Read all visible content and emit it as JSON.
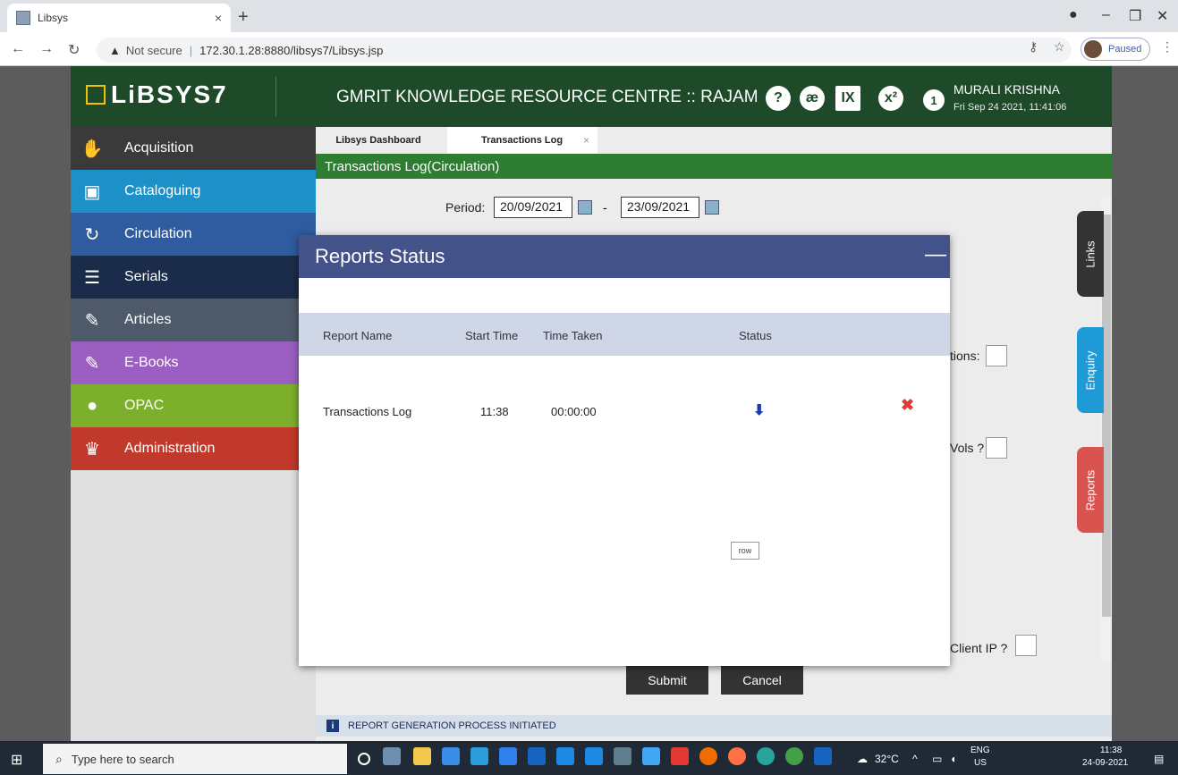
{
  "browser": {
    "tab_title": "Libsys",
    "tab_close": "×",
    "new_tab": "+",
    "url_warning": "▲",
    "url_secure_label": "Not secure",
    "url_separator": "|",
    "url": "172.30.1.28:8880/libsys7/Libsys.jsp",
    "profile_status": "Paused"
  },
  "header": {
    "logo_text": "LiBSYS7",
    "title": "GMRIT KNOWLEDGE RESOURCE CENTRE :: RAJAM",
    "notification_count": "1",
    "user_name": "MURALI KRISHNA",
    "user_datetime": "Fri Sep 24 2021, 11:41:06"
  },
  "sidebar": {
    "items": [
      {
        "label": "Acquisition",
        "icon": "handshake-icon",
        "color": "#3a3a3a"
      },
      {
        "label": "Cataloguing",
        "icon": "catalog-icon",
        "color": "#1e90c8"
      },
      {
        "label": "Circulation",
        "icon": "refresh-icon",
        "color": "#2f5c9e"
      },
      {
        "label": "Serials",
        "icon": "books-icon",
        "color": "#1b2c4a"
      },
      {
        "label": "Articles",
        "icon": "edit-icon",
        "color": "#4e5a6a"
      },
      {
        "label": "E-Books",
        "icon": "edit-icon",
        "color": "#9a5fc0"
      },
      {
        "label": "OPAC",
        "icon": "opac-icon",
        "color": "#7cb02c"
      },
      {
        "label": "Administration",
        "icon": "crown-icon",
        "color": "#c0392b"
      }
    ]
  },
  "content": {
    "tabs": [
      {
        "label": "Libsys Dashboard"
      },
      {
        "label": "Transactions Log"
      }
    ],
    "tab_close": "×",
    "section_title": "Transactions Log(Circulation)",
    "period_label": "Period:",
    "period_from": "20/09/2021",
    "period_to": "23/09/2021",
    "period_separator": "-",
    "option_label_1": "tions:",
    "option_label_2": "Vols ?",
    "option_label_3": "Client IP ?",
    "submit_label": "Submit",
    "cancel_label": "Cancel",
    "info_message": "REPORT GENERATION PROCESS INITIATED",
    "info_icon": "i",
    "side_tabs": [
      {
        "label": "Links",
        "color": "#333333"
      },
      {
        "label": "Enquiry",
        "color": "#1e9bd7"
      },
      {
        "label": "Reports",
        "color": "#d9534f"
      }
    ]
  },
  "modal": {
    "title": "Reports Status",
    "minimize": "—",
    "columns": [
      "Report Name",
      "Start Time",
      "Time Taken",
      "Status"
    ],
    "rows": [
      {
        "report_name": "Transactions Log",
        "start_time": "11:38",
        "time_taken": "00:00:00",
        "status_icon": "download-arrow-icon",
        "delete_icon": "delete-x-icon"
      }
    ],
    "row_tag": "row",
    "header_color": "#43538a"
  },
  "taskbar": {
    "search_placeholder": "Type here to search",
    "weather": "32°C",
    "lang_1": "ENG",
    "lang_2": "US",
    "time": "11:38",
    "date": "24-09-2021"
  }
}
